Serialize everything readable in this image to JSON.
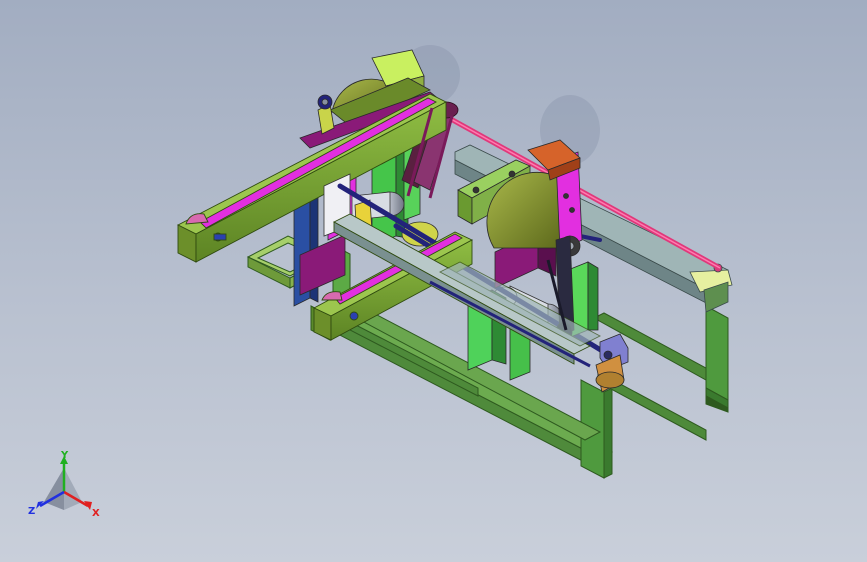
{
  "view": {
    "background_top": "#a2adc1",
    "background_bottom": "#c9cfda"
  },
  "model": {
    "parts": [
      "base-frame",
      "rear-saw-unit",
      "front-saw-unit",
      "drive-belts",
      "left-beam",
      "front-beam",
      "right-guide-rail",
      "motors",
      "shafts"
    ],
    "colors": {
      "frame": "#5b9b45",
      "beam": "#7aa33a",
      "beam_dark": "#55781f",
      "upright_green": "#46c04a",
      "magenta": "#e22fe0",
      "purple": "#8a1a78",
      "navy": "#23237a",
      "blade": "#7d8a2c",
      "belt": "#e0387a",
      "rail": "#8fa4a8",
      "orange": "#d6632a",
      "yellow_green": "#c9f060",
      "blue_post": "#2a4fa3",
      "steel": "#c8ccd6"
    }
  },
  "triad": {
    "x_label": "X",
    "y_label": "Y",
    "z_label": "Z",
    "x_color": "#e02020",
    "y_color": "#20b020",
    "z_color": "#2030e0"
  }
}
